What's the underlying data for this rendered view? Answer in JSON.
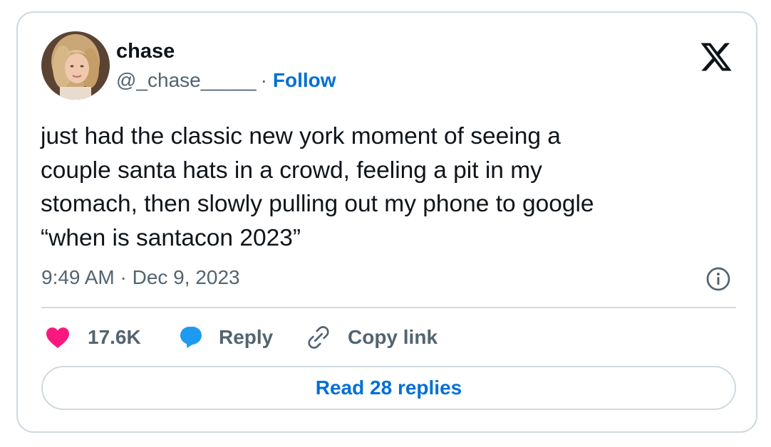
{
  "author": {
    "display_name": "chase",
    "handle": "@_chase_____",
    "separator": "·",
    "follow_label": "Follow"
  },
  "tweet": {
    "text_lines": [
      "just had the classic new york moment of seeing a",
      "couple santa hats in a crowd, feeling a pit in my",
      "stomach, then slowly pulling out my phone to google",
      "“when is santacon 2023”"
    ],
    "timestamp": "9:49 AM · Dec 9, 2023"
  },
  "actions": {
    "like_count": "17.6K",
    "reply_label": "Reply",
    "copy_link_label": "Copy link"
  },
  "read_replies_label": "Read 28 replies",
  "icons": {
    "brand": "x-logo-icon",
    "like": "heart-icon",
    "reply": "speech-bubble-icon",
    "copy": "link-icon",
    "info": "info-icon"
  },
  "colors": {
    "link_blue": "#006fd6",
    "like_pink": "#f91880",
    "reply_blue": "#1d9bf0",
    "text_primary": "#0f1419",
    "text_secondary": "#536471",
    "border": "#cfd9de"
  }
}
